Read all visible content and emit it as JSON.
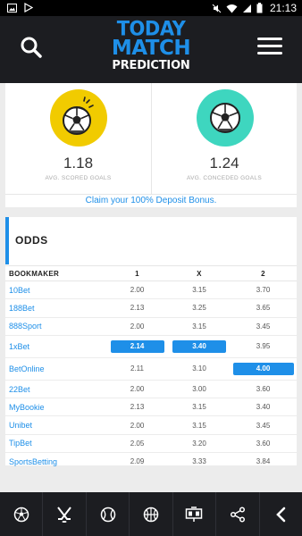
{
  "status_bar": {
    "time": "21:13"
  },
  "header": {
    "logo_line1": "TODAY",
    "logo_line2": "MATCH",
    "logo_line3": "PREDICTION"
  },
  "goals": {
    "scored": {
      "value": "1.18",
      "label": "AVG. SCORED GOALS",
      "color": "#f1cb00"
    },
    "conceded": {
      "value": "1.24",
      "label": "AVG. CONCEDED GOALS",
      "color": "#3ed6bf"
    }
  },
  "bonus_text": "Claim your 100% Deposit Bonus.",
  "odds": {
    "title": "ODDS",
    "headers": [
      "BOOKMAKER",
      "1",
      "X",
      "2"
    ],
    "rows": [
      {
        "bookmaker": "10Bet",
        "o1": "2.00",
        "ox": "3.15",
        "o2": "3.70"
      },
      {
        "bookmaker": "188Bet",
        "o1": "2.13",
        "ox": "3.25",
        "o2": "3.65"
      },
      {
        "bookmaker": "888Sport",
        "o1": "2.00",
        "ox": "3.15",
        "o2": "3.45"
      },
      {
        "bookmaker": "1xBet",
        "o1": "2.14",
        "ox": "3.40",
        "o2": "3.95"
      },
      {
        "bookmaker": "BetOnline",
        "o1": "2.11",
        "ox": "3.10",
        "o2": "4.00"
      },
      {
        "bookmaker": "22Bet",
        "o1": "2.00",
        "ox": "3.00",
        "o2": "3.60"
      },
      {
        "bookmaker": "MyBookie",
        "o1": "2.13",
        "ox": "3.15",
        "o2": "3.40"
      },
      {
        "bookmaker": "Unibet",
        "o1": "2.00",
        "ox": "3.15",
        "o2": "3.45"
      },
      {
        "bookmaker": "TipBet",
        "o1": "2.05",
        "ox": "3.20",
        "o2": "3.60"
      },
      {
        "bookmaker": "SportsBetting",
        "o1": "2.09",
        "ox": "3.33",
        "o2": "3.84"
      }
    ]
  },
  "bottom_nav": {
    "items": [
      "soccer-icon",
      "hockey-icon",
      "tennis-icon",
      "basketball-icon",
      "scoreboard-icon",
      "share-icon",
      "back-icon"
    ]
  },
  "colors": {
    "accent": "#1e8fe8",
    "dark": "#1c1d21"
  }
}
